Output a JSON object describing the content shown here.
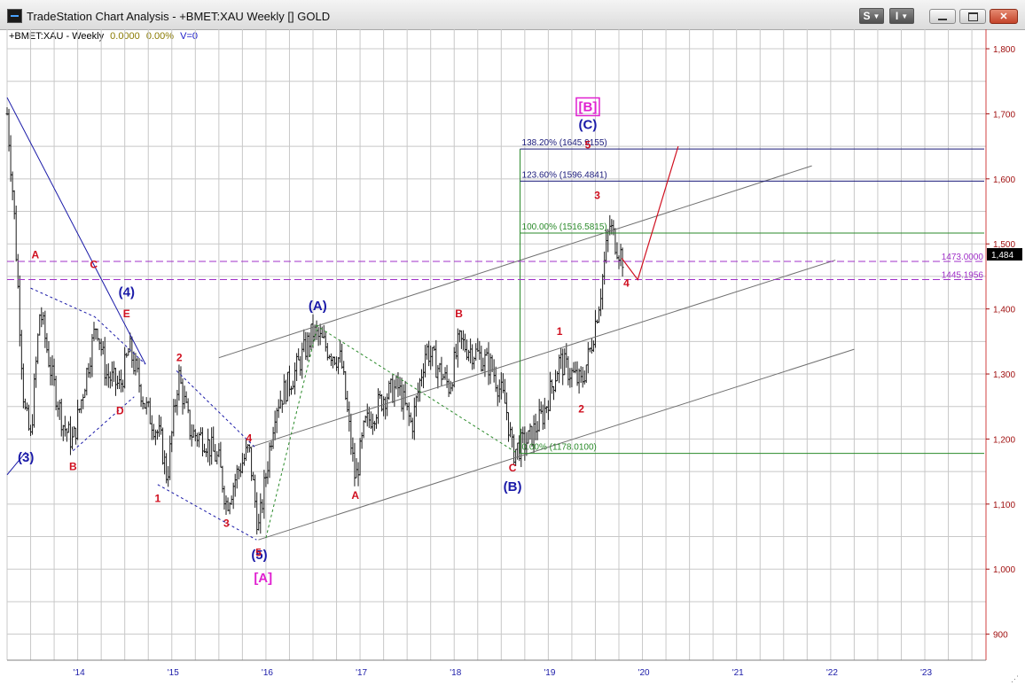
{
  "window": {
    "title": "TradeStation Chart Analysis - +BMET:XAU Weekly [] GOLD",
    "buttons": [
      {
        "label": "S",
        "name": "s-dropdown-button"
      },
      {
        "label": "I",
        "name": "i-dropdown-button"
      }
    ]
  },
  "symbol_info": {
    "symbol": "+BMET:XAU - Weekly",
    "change": "0.0000",
    "percent": "0.00%",
    "volume": "V=0"
  },
  "colors": {
    "price_bars": "#1a1a1a",
    "wave_red": "#d01020",
    "wave_blue": "#1a1aa8",
    "wave_magenta": "#e020d0",
    "fib_green": "#2a8a2a",
    "fib_navy": "#1a1a7a",
    "level_purple": "#a030c8",
    "axis_red": "#a01010",
    "grid": "#c8c8c8"
  },
  "chart_data": {
    "type": "ohlc",
    "ylim": [
      860,
      1830
    ],
    "y_ticks": [
      900,
      1000,
      1100,
      1200,
      1300,
      1400,
      1500,
      1600,
      1700,
      1800
    ],
    "y_tick_labels": [
      "900",
      "1,000",
      "1,100",
      "1,200",
      "1,300",
      "1,400",
      "1,500",
      "1,600",
      "1,700",
      "1,800"
    ],
    "xlim": [
      2013.25,
      2023.65
    ],
    "x_ticks": [
      2014,
      2015,
      2016,
      2017,
      2018,
      2019,
      2020,
      2021,
      2022,
      2023
    ],
    "x_tick_labels": [
      "'14",
      "'15",
      "'16",
      "'17",
      "'18",
      "'19",
      "'20",
      "'21",
      "'22",
      "'23"
    ],
    "last_price": 1484,
    "last_price_label": "1,484",
    "price_anchors": [
      [
        2013.25,
        1700
      ],
      [
        2013.32,
        1560
      ],
      [
        2013.43,
        1250
      ],
      [
        2013.5,
        1200
      ],
      [
        2013.6,
        1400
      ],
      [
        2013.72,
        1300
      ],
      [
        2013.85,
        1220
      ],
      [
        2013.95,
        1195
      ],
      [
        2014.2,
        1380
      ],
      [
        2014.3,
        1300
      ],
      [
        2014.45,
        1280
      ],
      [
        2014.55,
        1340
      ],
      [
        2014.72,
        1250
      ],
      [
        2014.88,
        1200
      ],
      [
        2014.95,
        1140
      ],
      [
        2015.07,
        1300
      ],
      [
        2015.2,
        1210
      ],
      [
        2015.35,
        1200
      ],
      [
        2015.5,
        1165
      ],
      [
        2015.58,
        1100
      ],
      [
        2015.7,
        1150
      ],
      [
        2015.82,
        1185
      ],
      [
        2015.92,
        1060
      ],
      [
        2016.1,
        1250
      ],
      [
        2016.3,
        1300
      ],
      [
        2016.5,
        1365
      ],
      [
        2016.65,
        1340
      ],
      [
        2016.8,
        1320
      ],
      [
        2016.95,
        1135
      ],
      [
        2017.05,
        1220
      ],
      [
        2017.25,
        1265
      ],
      [
        2017.4,
        1280
      ],
      [
        2017.55,
        1220
      ],
      [
        2017.7,
        1340
      ],
      [
        2017.95,
        1280
      ],
      [
        2018.05,
        1350
      ],
      [
        2018.25,
        1330
      ],
      [
        2018.4,
        1310
      ],
      [
        2018.55,
        1250
      ],
      [
        2018.62,
        1180
      ],
      [
        2018.8,
        1200
      ],
      [
        2018.95,
        1240
      ],
      [
        2019.12,
        1320
      ],
      [
        2019.25,
        1300
      ],
      [
        2019.35,
        1285
      ],
      [
        2019.45,
        1340
      ],
      [
        2019.55,
        1420
      ],
      [
        2019.65,
        1530
      ],
      [
        2019.72,
        1500
      ],
      [
        2019.8,
        1475
      ]
    ],
    "fib_levels": [
      {
        "label": "138.20% (1645.9155)",
        "value": 1645.9155,
        "color": "navy"
      },
      {
        "label": "123.60% (1596.4841)",
        "value": 1596.4841,
        "color": "navy"
      },
      {
        "label": "100.00% (1516.5815)",
        "value": 1516.5815,
        "color": "green"
      },
      {
        "label": "0.00% (1178.0100)",
        "value": 1178.01,
        "color": "green"
      }
    ],
    "horizontal_levels": [
      {
        "label": "1473.0000",
        "value": 1473
      },
      {
        "label": "1445.1956",
        "value": 1445.1956
      }
    ],
    "wave_labels": [
      {
        "t": "(3)",
        "x": 2013.45,
        "y": 1165,
        "color": "blue"
      },
      {
        "t": "(4)",
        "x": 2014.52,
        "y": 1419,
        "color": "blue"
      },
      {
        "t": "(5)",
        "x": 2015.93,
        "y": 1015,
        "color": "blue"
      },
      {
        "t": "[A]",
        "x": 2015.97,
        "y": 980,
        "color": "magenta"
      },
      {
        "t": "(A)",
        "x": 2016.55,
        "y": 1398,
        "color": "blue"
      },
      {
        "t": "(B)",
        "x": 2018.62,
        "y": 1120,
        "color": "blue"
      },
      {
        "t": "[B]",
        "x": 2019.42,
        "y": 1704,
        "color": "magenta"
      },
      {
        "t": "(C)",
        "x": 2019.42,
        "y": 1677,
        "color": "blue"
      },
      {
        "t": "A",
        "x": 2013.55,
        "y": 1478,
        "color": "red"
      },
      {
        "t": "C",
        "x": 2014.17,
        "y": 1463,
        "color": "red"
      },
      {
        "t": "E",
        "x": 2014.52,
        "y": 1387,
        "color": "red"
      },
      {
        "t": "D",
        "x": 2014.45,
        "y": 1238,
        "color": "red"
      },
      {
        "t": "B",
        "x": 2013.95,
        "y": 1152,
        "color": "red"
      },
      {
        "t": "2",
        "x": 2015.08,
        "y": 1320,
        "color": "red"
      },
      {
        "t": "1",
        "x": 2014.85,
        "y": 1103,
        "color": "red"
      },
      {
        "t": "3",
        "x": 2015.58,
        "y": 1065,
        "color": "red"
      },
      {
        "t": "4",
        "x": 2015.82,
        "y": 1196,
        "color": "red"
      },
      {
        "t": "5",
        "x": 2015.92,
        "y": 1020,
        "color": "red"
      },
      {
        "t": "A",
        "x": 2016.95,
        "y": 1108,
        "color": "red"
      },
      {
        "t": "B",
        "x": 2018.05,
        "y": 1387,
        "color": "red"
      },
      {
        "t": "C",
        "x": 2018.62,
        "y": 1150,
        "color": "red"
      },
      {
        "t": "1",
        "x": 2019.12,
        "y": 1360,
        "color": "red"
      },
      {
        "t": "2",
        "x": 2019.35,
        "y": 1241,
        "color": "red"
      },
      {
        "t": "3",
        "x": 2019.52,
        "y": 1569,
        "color": "red"
      },
      {
        "t": "4",
        "x": 2019.83,
        "y": 1434,
        "color": "red"
      },
      {
        "t": "5",
        "x": 2019.42,
        "y": 1647,
        "color": "red"
      }
    ],
    "projection_path": [
      [
        2019.78,
        1478
      ],
      [
        2019.95,
        1445
      ],
      [
        2020.38,
        1650
      ]
    ],
    "downtrend_lines": [
      {
        "from": [
          2013.25,
          1725
        ],
        "to": [
          2014.72,
          1315
        ]
      },
      {
        "from": [
          2013.25,
          1145
        ],
        "to": [
          2013.45,
          1180
        ]
      }
    ],
    "dotted_triangles": [
      {
        "points": [
          [
            2013.5,
            1432
          ],
          [
            2014.18,
            1388
          ],
          [
            2014.72,
            1315
          ]
        ],
        "style": "blue"
      },
      {
        "points": [
          [
            2013.95,
            1182
          ],
          [
            2014.6,
            1265
          ]
        ],
        "style": "blue"
      },
      {
        "points": [
          [
            2015.05,
            1305
          ],
          [
            2015.9,
            1185
          ]
        ],
        "style": "blue"
      },
      {
        "points": [
          [
            2014.85,
            1130
          ],
          [
            2015.9,
            1045
          ]
        ],
        "style": "blue"
      },
      {
        "points": [
          [
            2016.53,
            1375
          ],
          [
            2018.65,
            1180
          ]
        ],
        "style": "green"
      },
      {
        "points": [
          [
            2016.0,
            1048
          ],
          [
            2016.55,
            1375
          ]
        ],
        "style": "green"
      }
    ],
    "channel_lines": [
      {
        "from": [
          2015.5,
          1325
        ],
        "to": [
          2021.8,
          1620
        ]
      },
      {
        "from": [
          2015.78,
          1185
        ],
        "to": [
          2022.05,
          1475
        ]
      },
      {
        "from": [
          2015.92,
          1045
        ],
        "to": [
          2022.25,
          1338
        ]
      }
    ],
    "fib_vertical_x": 2018.7
  }
}
